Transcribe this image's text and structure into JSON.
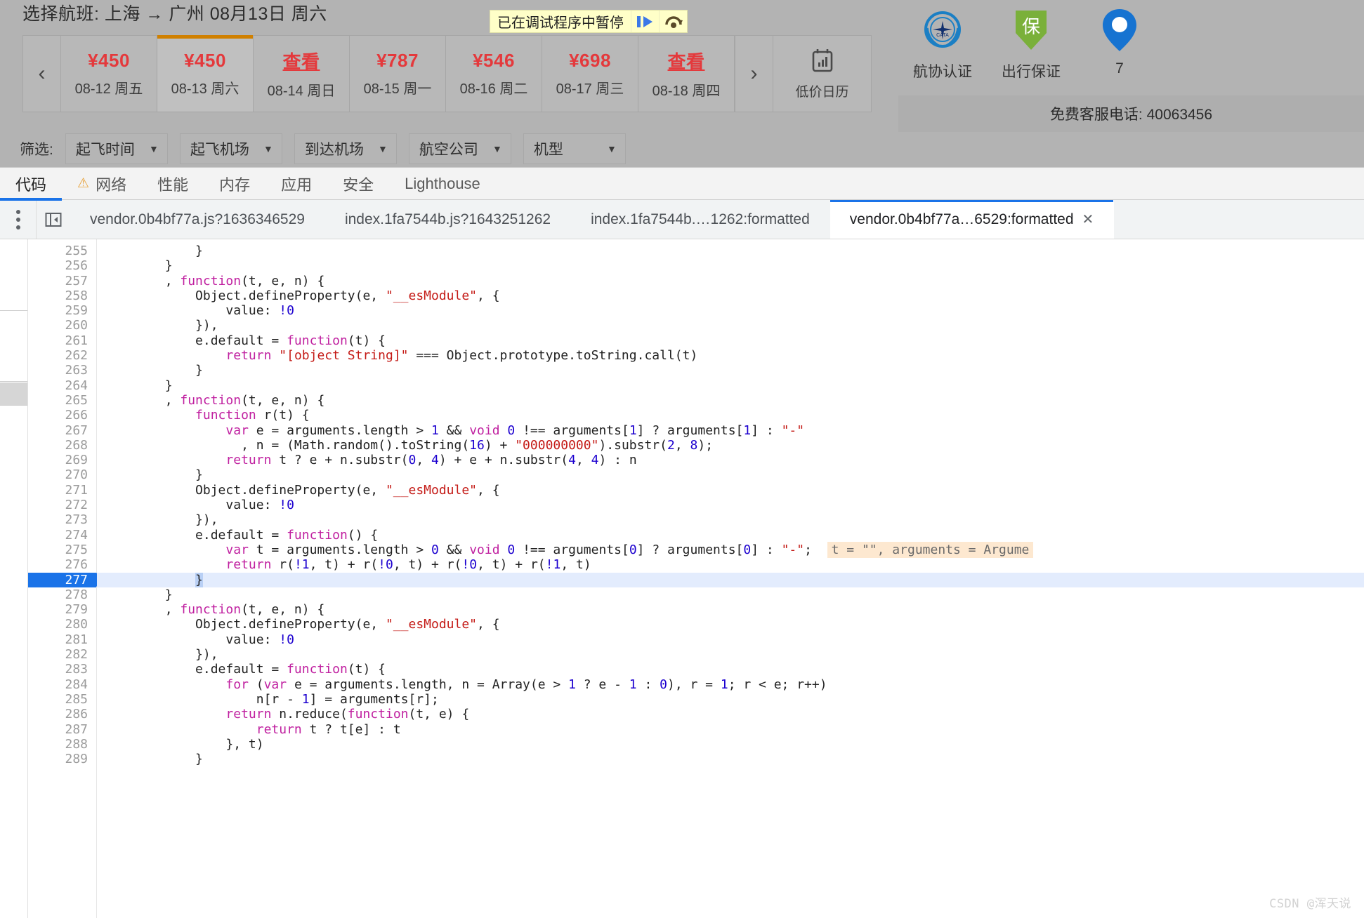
{
  "booking": {
    "title": "选择航班: 上海 → 广州 08月13日 周六",
    "prev_arrow": "‹",
    "next_arrow": "›",
    "dates": [
      {
        "price": "¥450",
        "day": "08-12 周五",
        "active": false,
        "is_link": false
      },
      {
        "price": "¥450",
        "day": "08-13 周六",
        "active": true,
        "is_link": false
      },
      {
        "price": "查看",
        "day": "08-14 周日",
        "active": false,
        "is_link": true
      },
      {
        "price": "¥787",
        "day": "08-15 周一",
        "active": false,
        "is_link": false
      },
      {
        "price": "¥546",
        "day": "08-16 周二",
        "active": false,
        "is_link": false
      },
      {
        "price": "¥698",
        "day": "08-17 周三",
        "active": false,
        "is_link": false
      },
      {
        "price": "查看",
        "day": "08-18 周四",
        "active": false,
        "is_link": true
      }
    ],
    "calendar_label": "低价日历",
    "calendar_icon": "calendar-chart-icon",
    "filter_label": "筛选:",
    "filters": [
      {
        "label": "起飞时间"
      },
      {
        "label": "起飞机场"
      },
      {
        "label": "到达机场"
      },
      {
        "label": "航空公司"
      },
      {
        "label": "机型"
      }
    ],
    "caret": "▼"
  },
  "sidebar": {
    "badges": [
      {
        "label": "航协认证",
        "icon": "cata-seal-icon",
        "color": "#1b7fc4"
      },
      {
        "label": "出行保证",
        "icon": "shield-bao-icon",
        "color": "#7ab03a"
      },
      {
        "label": "7",
        "icon": "phone-blue-icon",
        "color": "#1673d1"
      }
    ],
    "phone_text": "免费客服电话: 40063456"
  },
  "debugger_bar": {
    "text": "已在调试程序中暂停",
    "resume_icon": "resume-script-icon",
    "step_over_icon": "step-over-icon"
  },
  "devtools": {
    "panel_tabs": [
      {
        "label": "代码",
        "selected": true,
        "warn": false
      },
      {
        "label": "网络",
        "selected": false,
        "warn": true
      },
      {
        "label": "性能",
        "selected": false,
        "warn": false
      },
      {
        "label": "内存",
        "selected": false,
        "warn": false
      },
      {
        "label": "应用",
        "selected": false,
        "warn": false
      },
      {
        "label": "安全",
        "selected": false,
        "warn": false
      },
      {
        "label": "Lighthouse",
        "selected": false,
        "warn": false
      }
    ],
    "warn_icon": "warning-triangle-icon",
    "more_icon": "kebab-menu-icon",
    "panel_toggle_icon": "show-navigator-icon",
    "file_tabs": [
      {
        "label": "vendor.0b4bf77a.js?1636346529",
        "active": false,
        "closable": false
      },
      {
        "label": "index.1fa7544b.js?1643251262",
        "active": false,
        "closable": false
      },
      {
        "label": "index.1fa7544b.…1262:formatted",
        "active": false,
        "closable": false
      },
      {
        "label": "vendor.0b4bf77a…6529:formatted",
        "active": true,
        "closable": true
      }
    ],
    "close_icon": "close-icon"
  },
  "editor": {
    "first_line": 255,
    "current_line": 277,
    "inline_annotation": "t = \"\", arguments = Argume",
    "lines": [
      {
        "no": 255,
        "text": "            }"
      },
      {
        "no": 256,
        "text": "        }"
      },
      {
        "no": 257,
        "text": "        , function(t, e, n) {"
      },
      {
        "no": 258,
        "text": "            Object.defineProperty(e, \"__esModule\", {"
      },
      {
        "no": 259,
        "text": "                value: !0"
      },
      {
        "no": 260,
        "text": "            }),"
      },
      {
        "no": 261,
        "text": "            e.default = function(t) {"
      },
      {
        "no": 262,
        "text": "                return \"[object String]\" === Object.prototype.toString.call(t)"
      },
      {
        "no": 263,
        "text": "            }"
      },
      {
        "no": 264,
        "text": "        }"
      },
      {
        "no": 265,
        "text": "        , function(t, e, n) {"
      },
      {
        "no": 266,
        "text": "            function r(t) {"
      },
      {
        "no": 267,
        "text": "                var e = arguments.length > 1 && void 0 !== arguments[1] ? arguments[1] : \"-\""
      },
      {
        "no": 268,
        "text": "                  , n = (Math.random().toString(16) + \"000000000\").substr(2, 8);"
      },
      {
        "no": 269,
        "text": "                return t ? e + n.substr(0, 4) + e + n.substr(4, 4) : n"
      },
      {
        "no": 270,
        "text": "            }"
      },
      {
        "no": 271,
        "text": "            Object.defineProperty(e, \"__esModule\", {"
      },
      {
        "no": 272,
        "text": "                value: !0"
      },
      {
        "no": 273,
        "text": "            }),"
      },
      {
        "no": 274,
        "text": "            e.default = function() {"
      },
      {
        "no": 275,
        "text": "                var t = arguments.length > 0 && void 0 !== arguments[0] ? arguments[0] : \"-\";"
      },
      {
        "no": 276,
        "text": "                return r(!1, t) + r(!0, t) + r(!0, t) + r(!1, t)"
      },
      {
        "no": 277,
        "text": "            }"
      },
      {
        "no": 278,
        "text": "        }"
      },
      {
        "no": 279,
        "text": "        , function(t, e, n) {"
      },
      {
        "no": 280,
        "text": "            Object.defineProperty(e, \"__esModule\", {"
      },
      {
        "no": 281,
        "text": "                value: !0"
      },
      {
        "no": 282,
        "text": "            }),"
      },
      {
        "no": 283,
        "text": "            e.default = function(t) {"
      },
      {
        "no": 284,
        "text": "                for (var e = arguments.length, n = Array(e > 1 ? e - 1 : 0), r = 1; r < e; r++)"
      },
      {
        "no": 285,
        "text": "                    n[r - 1] = arguments[r];"
      },
      {
        "no": 286,
        "text": "                return n.reduce(function(t, e) {"
      },
      {
        "no": 287,
        "text": "                    return t ? t[e] : t"
      },
      {
        "no": 288,
        "text": "                }, t)"
      },
      {
        "no": 289,
        "text": "            }"
      }
    ]
  },
  "watermark": "CSDN @浑天说",
  "colors": {
    "accent_blue": "#1a73e8",
    "price_red": "#e4393c",
    "selected_tab_underline": "#d08000",
    "paused_bg": "#ffffc8",
    "highlight_line": "#e3ecfd"
  }
}
